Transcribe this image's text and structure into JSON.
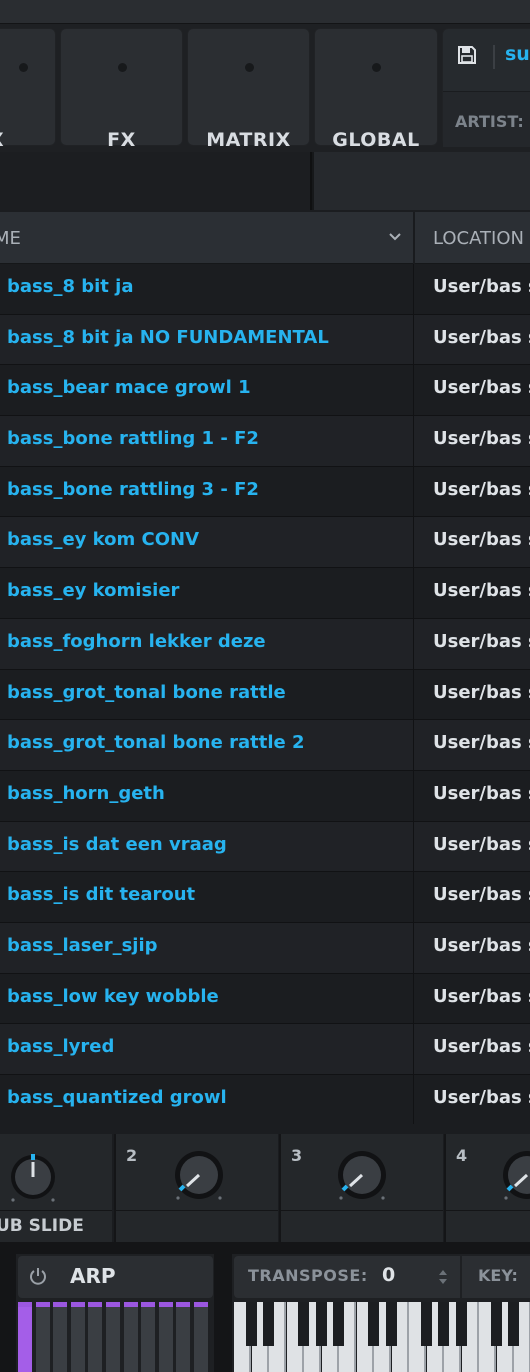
{
  "nav_tabs": [
    {
      "label": "X"
    },
    {
      "label": "FX"
    },
    {
      "label": "MATRIX"
    },
    {
      "label": "GLOBAL"
    }
  ],
  "preset": {
    "name": "sul",
    "artist_label": "ARTIST:"
  },
  "browser": {
    "columns": {
      "name": "ME",
      "location": "LOCATION"
    },
    "rows": [
      {
        "name": "bass_8 bit ja",
        "location": "User/bas s"
      },
      {
        "name": "bass_8 bit ja NO FUNDAMENTAL",
        "location": "User/bas s"
      },
      {
        "name": "bass_bear mace growl 1",
        "location": "User/bas s"
      },
      {
        "name": "bass_bone rattling 1 - F2",
        "location": "User/bas s"
      },
      {
        "name": "bass_bone rattling 3 - F2",
        "location": "User/bas s"
      },
      {
        "name": "bass_ey kom CONV",
        "location": "User/bas s"
      },
      {
        "name": "bass_ey komisier",
        "location": "User/bas s"
      },
      {
        "name": "bass_foghorn lekker deze",
        "location": "User/bas s"
      },
      {
        "name": "bass_grot_tonal bone rattle",
        "location": "User/bas s"
      },
      {
        "name": "bass_grot_tonal bone rattle 2",
        "location": "User/bas s"
      },
      {
        "name": "bass_horn_geth",
        "location": "User/bas s"
      },
      {
        "name": "bass_is dat een vraag",
        "location": "User/bas s"
      },
      {
        "name": "bass_is dit tearout",
        "location": "User/bas s"
      },
      {
        "name": "bass_laser_sjip",
        "location": "User/bas s"
      },
      {
        "name": "bass_low key wobble",
        "location": "User/bas s"
      },
      {
        "name": "bass_lyred",
        "location": "User/bas s"
      },
      {
        "name": "bass_quantized growl",
        "location": "User/bas s"
      }
    ]
  },
  "macros": [
    {
      "number": "",
      "label": "UB SLIDE",
      "value": 0.5
    },
    {
      "number": "2",
      "label": "",
      "value": 0.0
    },
    {
      "number": "3",
      "label": "",
      "value": 0.0
    },
    {
      "number": "4",
      "label": "",
      "value": 0.0
    }
  ],
  "arp": {
    "label": "ARP"
  },
  "transpose": {
    "label": "TRANSPOSE:",
    "value": "0"
  },
  "key": {
    "label": "KEY:"
  },
  "colors": {
    "accent_blue": "#27b3ef",
    "arp_purple": "#a45ee8"
  }
}
